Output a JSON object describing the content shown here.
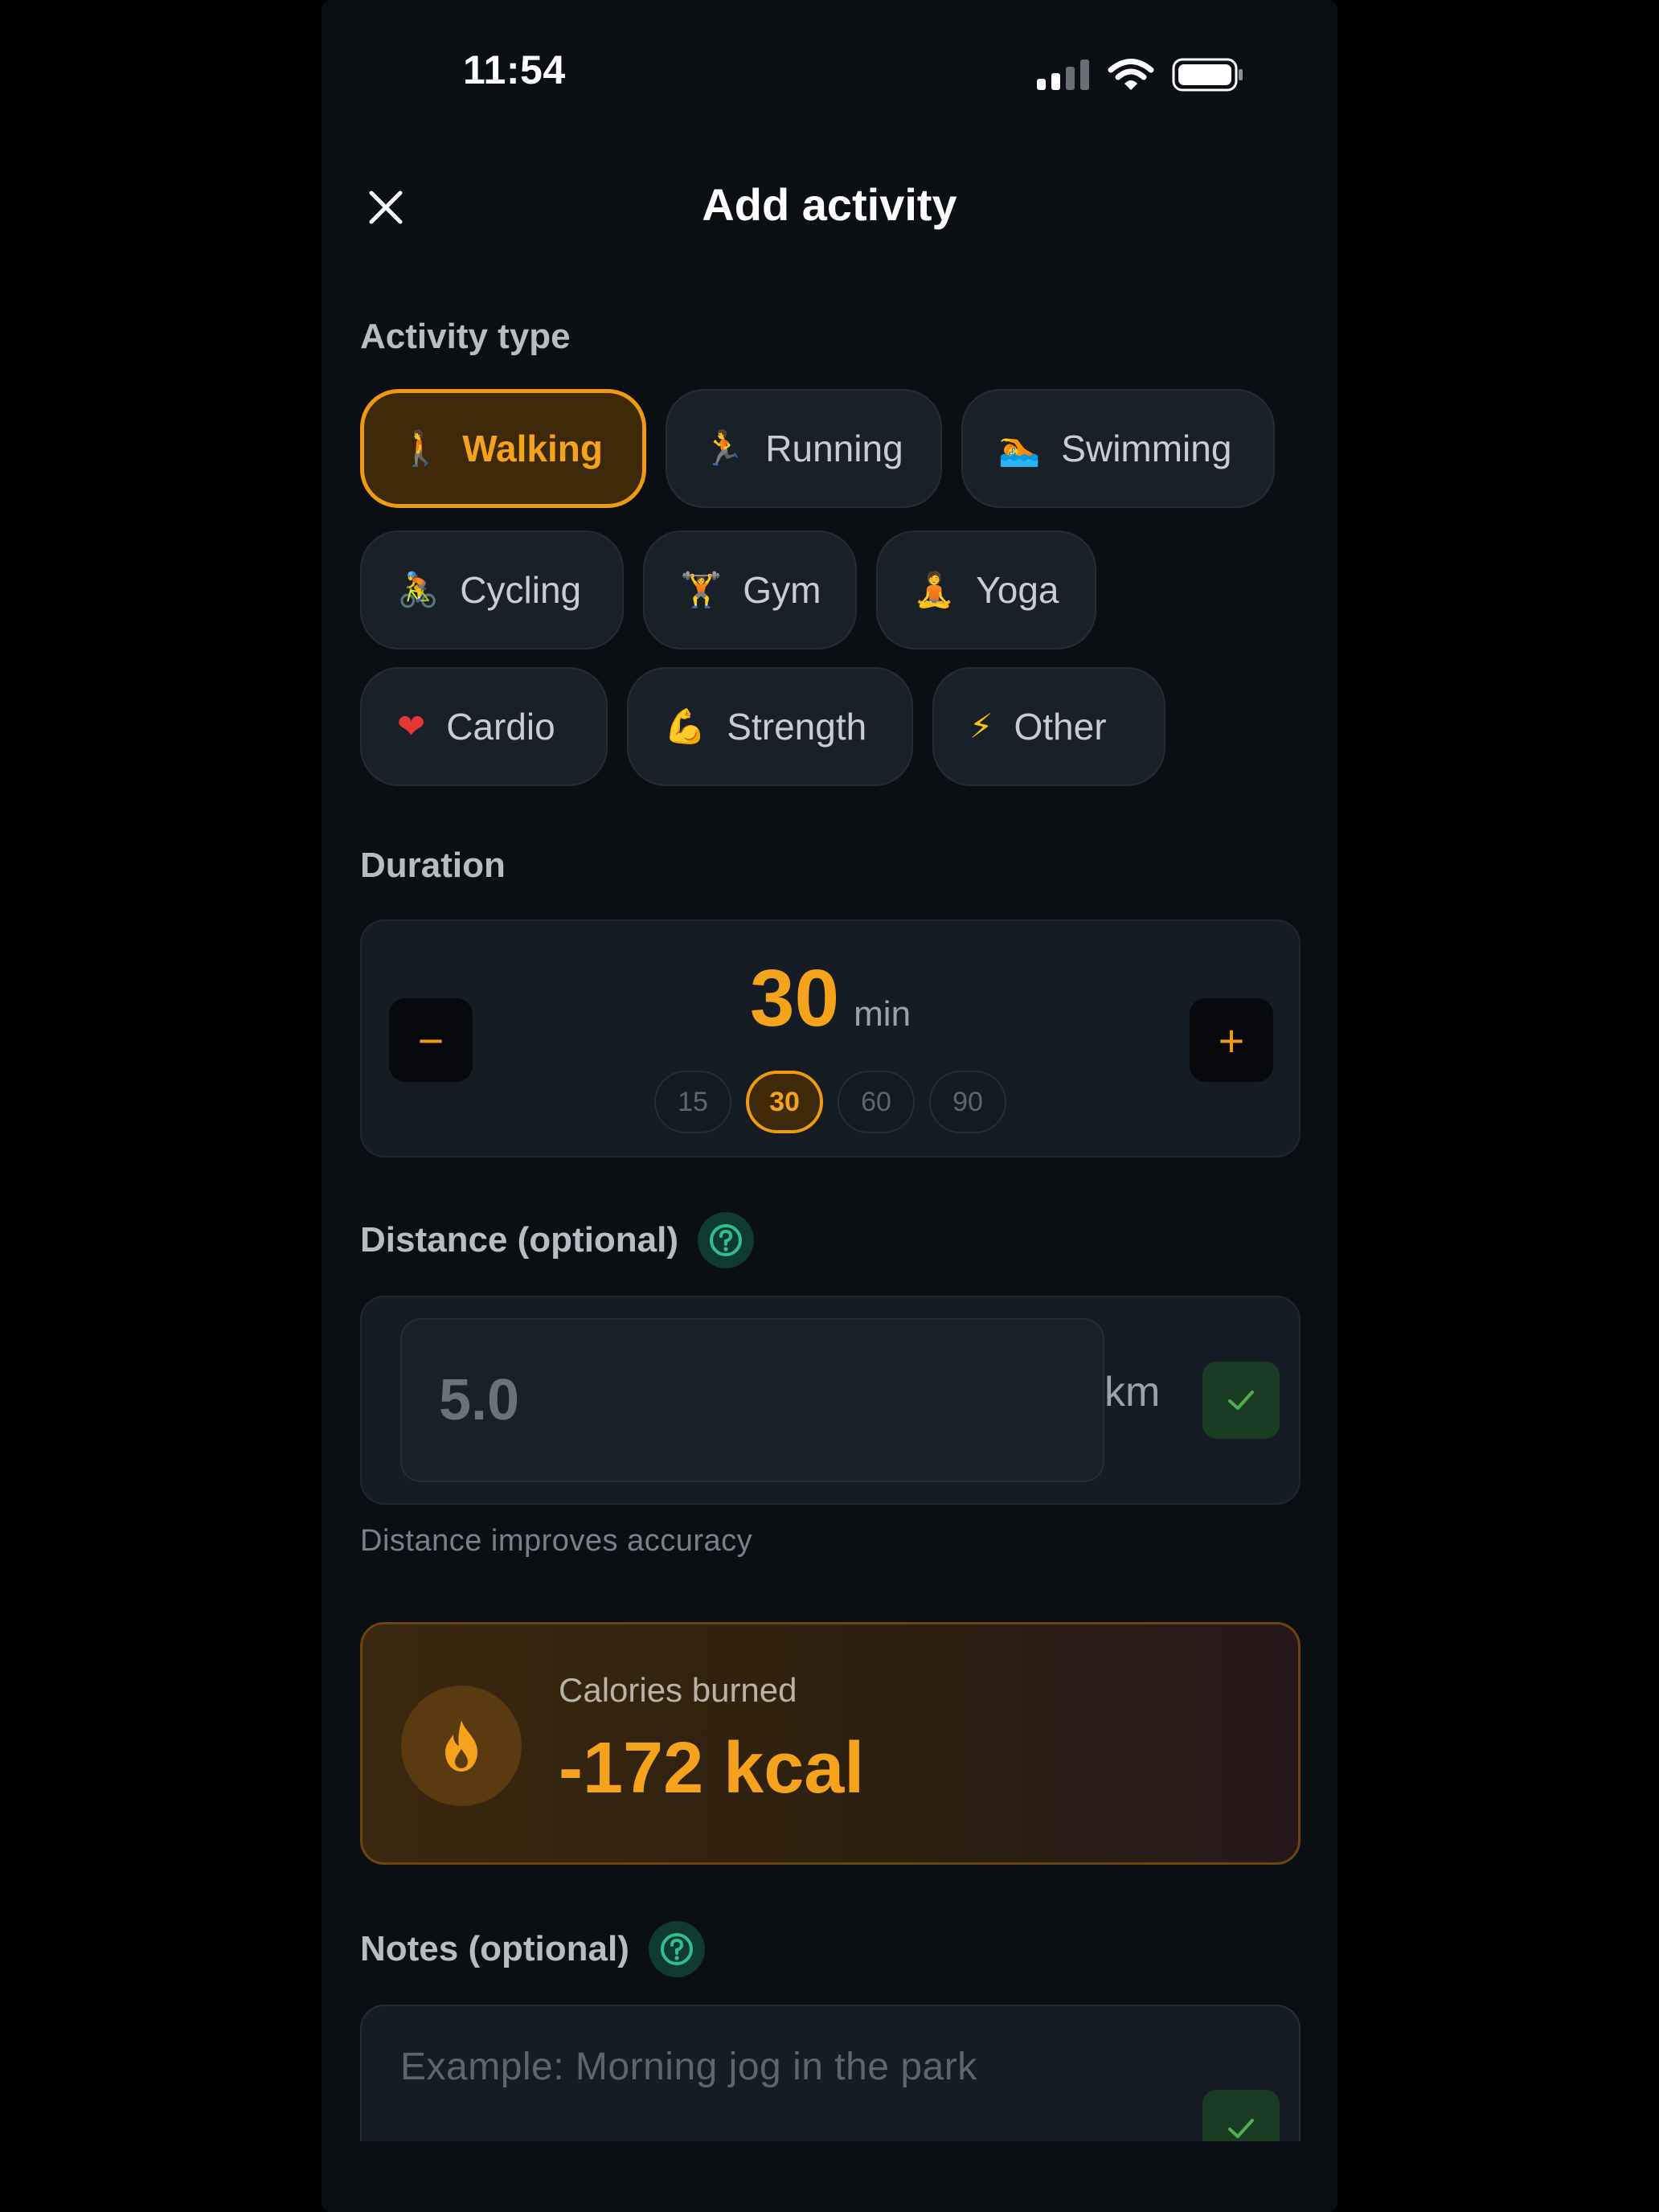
{
  "status_bar": {
    "time": "11:54"
  },
  "header": {
    "title": "Add activity",
    "close_icon": "close-icon"
  },
  "activity_type": {
    "label": "Activity type",
    "options": [
      {
        "emoji": "🚶",
        "label": "Walking",
        "selected": true
      },
      {
        "emoji": "🏃",
        "label": "Running",
        "selected": false
      },
      {
        "emoji": "🏊",
        "label": "Swimming",
        "selected": false
      },
      {
        "emoji": "🚴",
        "label": "Cycling",
        "selected": false
      },
      {
        "emoji": "🏋",
        "label": "Gym",
        "selected": false
      },
      {
        "emoji": "🧘",
        "label": "Yoga",
        "selected": false
      },
      {
        "emoji": "❤",
        "label": "Cardio",
        "selected": false
      },
      {
        "emoji": "💪",
        "label": "Strength",
        "selected": false
      },
      {
        "emoji": "⚡",
        "label": "Other",
        "selected": false
      }
    ]
  },
  "duration": {
    "label": "Duration",
    "value": "30",
    "unit": "min",
    "minus": "−",
    "plus": "+",
    "presets": [
      "15",
      "30",
      "60",
      "90"
    ],
    "selected_preset": "30"
  },
  "distance": {
    "label": "Distance (optional)",
    "placeholder": "5.0",
    "unit": "km",
    "hint": "Distance improves accuracy"
  },
  "calories": {
    "label": "Calories burned",
    "value": "-172 kcal"
  },
  "notes": {
    "label": "Notes (optional)",
    "placeholder": "Example: Morning jog in the park"
  },
  "colors": {
    "background": "#0b0e13",
    "accent": "#f5a21c",
    "help_icon": "#2fbf8f",
    "confirm": "#4caf50"
  }
}
